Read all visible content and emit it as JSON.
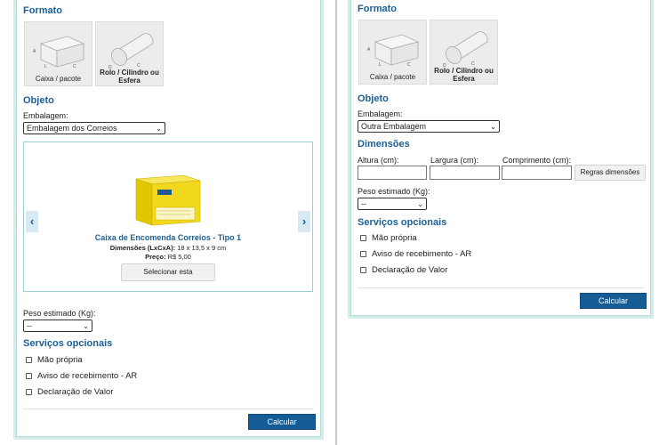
{
  "left": {
    "formato_title": "Formato",
    "shapes": [
      {
        "label": "Caixa / pacote"
      },
      {
        "label": "Rolo / Cilindro ou Esfera"
      }
    ],
    "objeto_title": "Objeto",
    "embalagem_label": "Embalagem:",
    "embalagem_value": "Embalagem dos Correios",
    "product": {
      "title": "Caixa de Encomenda Correios - Tipo 1",
      "dims_label": "Dimensões (LxCxA):",
      "dims_value": "18 x 13,5 x 9 cm",
      "price_label": "Preço:",
      "price_value": "R$ 5,00",
      "select_label": "Selecionar esta"
    },
    "peso_label": "Peso estimado (Kg):",
    "peso_value": "--",
    "servicos_title": "Serviços opcionais",
    "options": [
      "Mão própria",
      "Aviso de recebimento - AR",
      "Declaração de Valor"
    ],
    "submit_label": "Calcular"
  },
  "right": {
    "formato_title": "Formato",
    "shapes": [
      {
        "label": "Caixa / pacote"
      },
      {
        "label": "Rolo / Cilindro ou Esfera"
      }
    ],
    "objeto_title": "Objeto",
    "embalagem_label": "Embalagem:",
    "embalagem_value": "Outra Embalagem",
    "dimensoes_title": "Dimensões",
    "altura_label": "Altura (cm):",
    "largura_label": "Largura (cm):",
    "comprimento_label": "Comprimento (cm):",
    "regras_label": "Regras dimensões",
    "peso_label": "Peso estimado (Kg):",
    "peso_value": "--",
    "servicos_title": "Serviços opcionais",
    "options": [
      "Mão própria",
      "Aviso de recebimento - AR",
      "Declaração de Valor"
    ],
    "submit_label": "Calcular"
  },
  "colors": {
    "accent": "#1b5f96",
    "button": "#155b94",
    "border": "#b5dcd7",
    "box_yellow": "#f2d81c"
  },
  "icons": {
    "prev": "chevron-left-icon",
    "next": "chevron-right-icon",
    "box": "box-icon",
    "cylinder": "cylinder-icon"
  }
}
